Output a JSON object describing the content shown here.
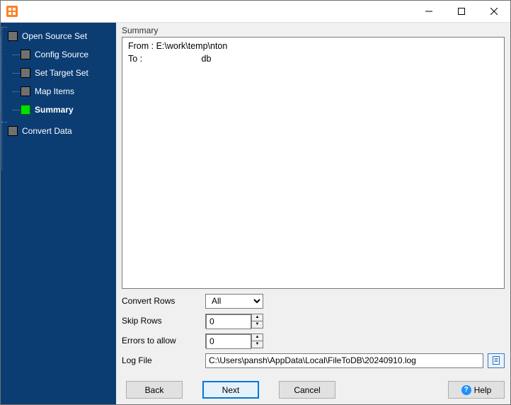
{
  "sidebar": {
    "root": [
      {
        "label": "Open Source Set",
        "children": [
          {
            "label": "Config Source"
          },
          {
            "label": "Set Target Set"
          },
          {
            "label": "Map Items"
          },
          {
            "label": "Summary",
            "active": true
          }
        ]
      },
      {
        "label": "Convert Data"
      }
    ]
  },
  "main": {
    "section_title": "Summary",
    "summary_text": "From : E:\\work\\temp\\nton\nTo :                        db"
  },
  "form": {
    "convert_rows": {
      "label": "Convert Rows",
      "value": "All"
    },
    "skip_rows": {
      "label": "Skip Rows",
      "value": "0"
    },
    "errors_allow": {
      "label": "Errors to allow",
      "value": "0"
    },
    "log_file": {
      "label": "Log File",
      "value": "C:\\Users\\pansh\\AppData\\Local\\FileToDB\\20240910.log"
    }
  },
  "buttons": {
    "back": "Back",
    "next": "Next",
    "cancel": "Cancel",
    "help": "Help"
  }
}
